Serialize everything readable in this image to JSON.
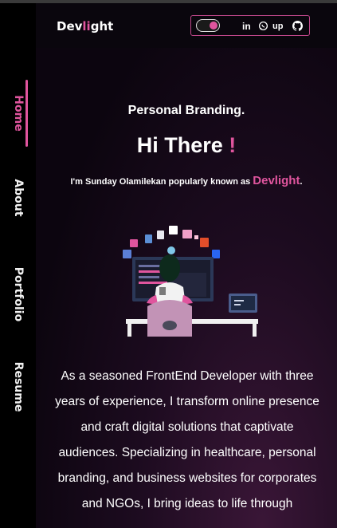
{
  "sidebar": {
    "items": [
      {
        "label": "Home",
        "active": true
      },
      {
        "label": "About",
        "active": false
      },
      {
        "label": "Portfolio",
        "active": false
      },
      {
        "label": "Resume",
        "active": false
      }
    ]
  },
  "header": {
    "logo": {
      "part1": "Dev",
      "part2": "li",
      "part3": "ght"
    },
    "theme_toggle": {
      "state": "on"
    },
    "social": {
      "linkedin": "in",
      "whatsapp": "whatsapp-icon",
      "upwork": "up",
      "github": "github-icon"
    }
  },
  "hero": {
    "subtitle": "Personal Branding.",
    "greeting": "Hi There",
    "greeting_mark": "!",
    "intro_prefix": "I'm Sunday Olamilekan popularly known as ",
    "intro_brand": "Devlight",
    "intro_suffix": "."
  },
  "bio": "As a seasoned FrontEnd Developer with three years of experience, I transform online presence and craft digital solutions that captivate audiences. Specializing in healthcare, personal branding, and business websites for corporates and NGOs, I bring ideas to life through",
  "colors": {
    "accent": "#e0559e",
    "background": "#0c050f",
    "sidebar": "#000000"
  }
}
